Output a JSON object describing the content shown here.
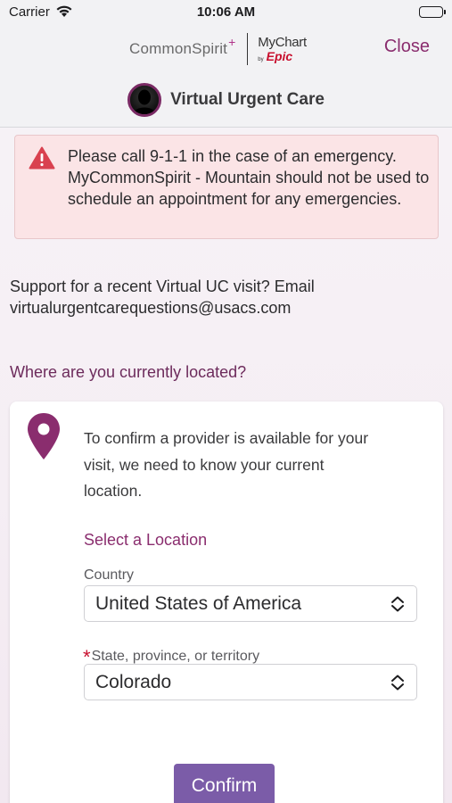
{
  "status_bar": {
    "carrier": "Carrier",
    "time": "10:06 AM"
  },
  "header": {
    "brand_name": "CommonSpirit",
    "brand_plus": "+",
    "mychart": "MyChart",
    "by": "by",
    "epic": "Epic",
    "close_label": "Close",
    "page_title": "Virtual Urgent Care"
  },
  "alert": {
    "icon": "warning-triangle-icon",
    "color": "#d9414f",
    "text": "Please call 9-1-1 in the case of an emergency. MyCommonSpirit - Mountain should not be used to schedule an appointment for any emergencies."
  },
  "support": {
    "text": "Support for a recent Virtual UC visit? Email virtualurgentcarequestions@usacs.com"
  },
  "location": {
    "question": "Where are you currently located?",
    "description": "To confirm a provider is available for your visit, we need to know your current location.",
    "select_heading": "Select a Location",
    "country_label": "Country",
    "country_value": "United States of America",
    "state_required_marker": "*",
    "state_label": "State, province, or territory",
    "state_value": "Colorado",
    "confirm_label": "Confirm"
  },
  "colors": {
    "accent": "#8a2d6e",
    "button": "#7b5ca8",
    "alert_bg": "#fbe4e6",
    "pin": "#8a2d6e"
  }
}
